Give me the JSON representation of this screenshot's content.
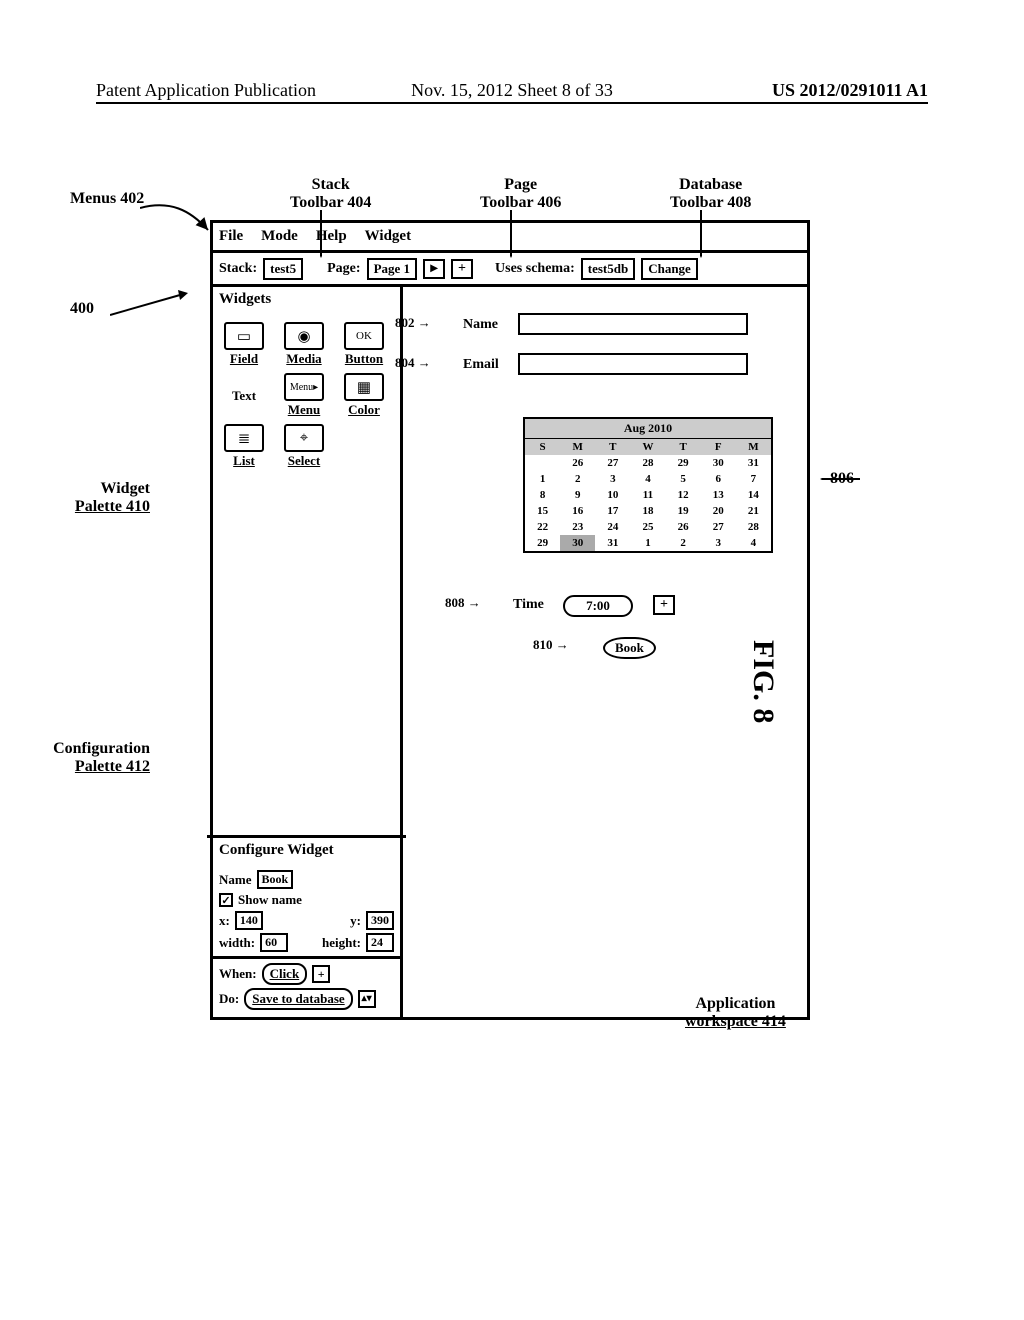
{
  "header": {
    "left": "Patent Application Publication",
    "center": "Nov. 15, 2012  Sheet 8 of 33",
    "right": "US 2012/0291011 A1"
  },
  "figure_label": "FIG. 8",
  "callouts": {
    "menus": "Menus 402",
    "stack_toolbar_a": "Stack",
    "stack_toolbar_b": "Toolbar 404",
    "page_toolbar_a": "Page",
    "page_toolbar_b": "Toolbar 406",
    "db_toolbar_a": "Database",
    "db_toolbar_b": "Toolbar 408",
    "widget_palette_a": "Widget",
    "widget_palette_b": "Palette 410",
    "config_palette_a": "Configuration",
    "config_palette_b": "Palette 412",
    "app_ws_a": "Application",
    "app_ws_b": "workspace 414",
    "ref400": "400",
    "ref802": "802",
    "ref804": "804",
    "ref806": "806",
    "ref808": "808",
    "ref810": "810"
  },
  "menubar": {
    "file": "File",
    "mode": "Mode",
    "help": "Help",
    "widget": "Widget"
  },
  "toolbar": {
    "stack_label": "Stack:",
    "stack_value": "test5",
    "page_label": "Page:",
    "page_value": "Page 1",
    "page_add": "+",
    "schema_label": "Uses schema:",
    "schema_value": "test5db",
    "change": "Change"
  },
  "palette": {
    "title": "Widgets",
    "items": [
      {
        "icon": "▭",
        "label": "Field"
      },
      {
        "icon": "◉",
        "label": "Media"
      },
      {
        "icon": "OK",
        "label": "Button"
      },
      {
        "icon": "Menu▸",
        "label": "Menu"
      },
      {
        "icon": "▦",
        "label": "Color"
      },
      {
        "icon": "≣",
        "label": "List"
      },
      {
        "icon": "⌖",
        "label": "Select"
      }
    ],
    "text_label": "Text"
  },
  "config": {
    "title": "Configure Widget",
    "name_label": "Name",
    "name_value": "Book",
    "showname_label": "Show name",
    "showname_checked": true,
    "x_label": "x:",
    "x_value": "140",
    "y_label": "y:",
    "y_value": "390",
    "w_label": "width:",
    "w_value": "60",
    "h_label": "height:",
    "h_value": "24",
    "when_label": "When:",
    "when_value": "Click",
    "do_label": "Do:",
    "do_value": "Save to database",
    "add_icon": "+",
    "updown_icon": "▴▾"
  },
  "workspace": {
    "name_label": "Name",
    "email_label": "Email",
    "time_label": "Time",
    "time_value": "7:00",
    "time_icon": "+",
    "book_label": "Book",
    "calendar": {
      "month": "Aug 2010",
      "dow": [
        "S",
        "M",
        "T",
        "W",
        "T",
        "F",
        "M"
      ],
      "rows": [
        [
          "",
          "26",
          "27",
          "28",
          "29",
          "30",
          "31"
        ],
        [
          "1",
          "2",
          "3",
          "4",
          "5",
          "6",
          "7"
        ],
        [
          "8",
          "9",
          "10",
          "11",
          "12",
          "13",
          "14"
        ],
        [
          "15",
          "16",
          "17",
          "18",
          "19",
          "20",
          "21"
        ],
        [
          "22",
          "23",
          "24",
          "25",
          "26",
          "27",
          "28"
        ],
        [
          "29",
          "30",
          "31",
          "1",
          "2",
          "3",
          "4"
        ]
      ],
      "highlight": "30"
    }
  }
}
